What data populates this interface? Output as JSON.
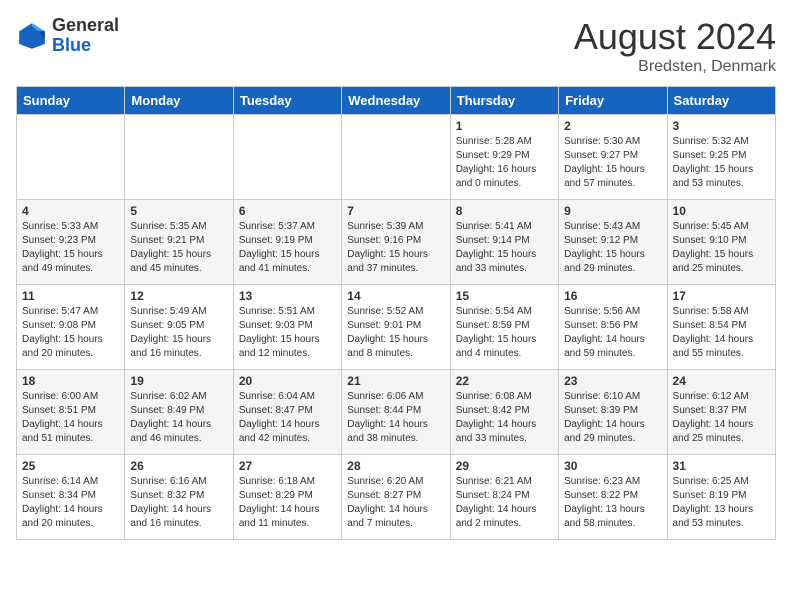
{
  "header": {
    "logo_general": "General",
    "logo_blue": "Blue",
    "month_year": "August 2024",
    "location": "Bredsten, Denmark"
  },
  "days_of_week": [
    "Sunday",
    "Monday",
    "Tuesday",
    "Wednesday",
    "Thursday",
    "Friday",
    "Saturday"
  ],
  "weeks": [
    [
      {
        "day": "",
        "info": ""
      },
      {
        "day": "",
        "info": ""
      },
      {
        "day": "",
        "info": ""
      },
      {
        "day": "",
        "info": ""
      },
      {
        "day": "1",
        "info": "Sunrise: 5:28 AM\nSunset: 9:29 PM\nDaylight: 16 hours\nand 0 minutes."
      },
      {
        "day": "2",
        "info": "Sunrise: 5:30 AM\nSunset: 9:27 PM\nDaylight: 15 hours\nand 57 minutes."
      },
      {
        "day": "3",
        "info": "Sunrise: 5:32 AM\nSunset: 9:25 PM\nDaylight: 15 hours\nand 53 minutes."
      }
    ],
    [
      {
        "day": "4",
        "info": "Sunrise: 5:33 AM\nSunset: 9:23 PM\nDaylight: 15 hours\nand 49 minutes."
      },
      {
        "day": "5",
        "info": "Sunrise: 5:35 AM\nSunset: 9:21 PM\nDaylight: 15 hours\nand 45 minutes."
      },
      {
        "day": "6",
        "info": "Sunrise: 5:37 AM\nSunset: 9:19 PM\nDaylight: 15 hours\nand 41 minutes."
      },
      {
        "day": "7",
        "info": "Sunrise: 5:39 AM\nSunset: 9:16 PM\nDaylight: 15 hours\nand 37 minutes."
      },
      {
        "day": "8",
        "info": "Sunrise: 5:41 AM\nSunset: 9:14 PM\nDaylight: 15 hours\nand 33 minutes."
      },
      {
        "day": "9",
        "info": "Sunrise: 5:43 AM\nSunset: 9:12 PM\nDaylight: 15 hours\nand 29 minutes."
      },
      {
        "day": "10",
        "info": "Sunrise: 5:45 AM\nSunset: 9:10 PM\nDaylight: 15 hours\nand 25 minutes."
      }
    ],
    [
      {
        "day": "11",
        "info": "Sunrise: 5:47 AM\nSunset: 9:08 PM\nDaylight: 15 hours\nand 20 minutes."
      },
      {
        "day": "12",
        "info": "Sunrise: 5:49 AM\nSunset: 9:05 PM\nDaylight: 15 hours\nand 16 minutes."
      },
      {
        "day": "13",
        "info": "Sunrise: 5:51 AM\nSunset: 9:03 PM\nDaylight: 15 hours\nand 12 minutes."
      },
      {
        "day": "14",
        "info": "Sunrise: 5:52 AM\nSunset: 9:01 PM\nDaylight: 15 hours\nand 8 minutes."
      },
      {
        "day": "15",
        "info": "Sunrise: 5:54 AM\nSunset: 8:59 PM\nDaylight: 15 hours\nand 4 minutes."
      },
      {
        "day": "16",
        "info": "Sunrise: 5:56 AM\nSunset: 8:56 PM\nDaylight: 14 hours\nand 59 minutes."
      },
      {
        "day": "17",
        "info": "Sunrise: 5:58 AM\nSunset: 8:54 PM\nDaylight: 14 hours\nand 55 minutes."
      }
    ],
    [
      {
        "day": "18",
        "info": "Sunrise: 6:00 AM\nSunset: 8:51 PM\nDaylight: 14 hours\nand 51 minutes."
      },
      {
        "day": "19",
        "info": "Sunrise: 6:02 AM\nSunset: 8:49 PM\nDaylight: 14 hours\nand 46 minutes."
      },
      {
        "day": "20",
        "info": "Sunrise: 6:04 AM\nSunset: 8:47 PM\nDaylight: 14 hours\nand 42 minutes."
      },
      {
        "day": "21",
        "info": "Sunrise: 6:06 AM\nSunset: 8:44 PM\nDaylight: 14 hours\nand 38 minutes."
      },
      {
        "day": "22",
        "info": "Sunrise: 6:08 AM\nSunset: 8:42 PM\nDaylight: 14 hours\nand 33 minutes."
      },
      {
        "day": "23",
        "info": "Sunrise: 6:10 AM\nSunset: 8:39 PM\nDaylight: 14 hours\nand 29 minutes."
      },
      {
        "day": "24",
        "info": "Sunrise: 6:12 AM\nSunset: 8:37 PM\nDaylight: 14 hours\nand 25 minutes."
      }
    ],
    [
      {
        "day": "25",
        "info": "Sunrise: 6:14 AM\nSunset: 8:34 PM\nDaylight: 14 hours\nand 20 minutes."
      },
      {
        "day": "26",
        "info": "Sunrise: 6:16 AM\nSunset: 8:32 PM\nDaylight: 14 hours\nand 16 minutes."
      },
      {
        "day": "27",
        "info": "Sunrise: 6:18 AM\nSunset: 8:29 PM\nDaylight: 14 hours\nand 11 minutes."
      },
      {
        "day": "28",
        "info": "Sunrise: 6:20 AM\nSunset: 8:27 PM\nDaylight: 14 hours\nand 7 minutes."
      },
      {
        "day": "29",
        "info": "Sunrise: 6:21 AM\nSunset: 8:24 PM\nDaylight: 14 hours\nand 2 minutes."
      },
      {
        "day": "30",
        "info": "Sunrise: 6:23 AM\nSunset: 8:22 PM\nDaylight: 13 hours\nand 58 minutes."
      },
      {
        "day": "31",
        "info": "Sunrise: 6:25 AM\nSunset: 8:19 PM\nDaylight: 13 hours\nand 53 minutes."
      }
    ]
  ]
}
